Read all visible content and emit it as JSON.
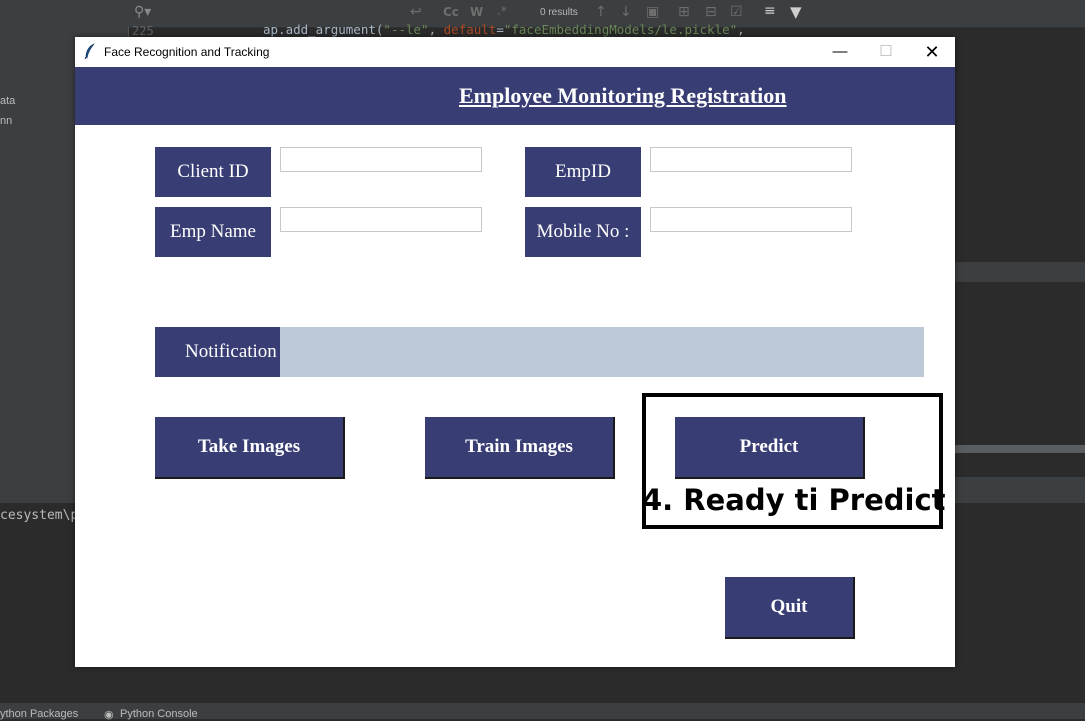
{
  "ide": {
    "line_number": "225",
    "code_prefix": "ap.add_argument(",
    "code_arg1": "\"--le\"",
    "code_sep": ", ",
    "code_kw": "default",
    "code_eq": "=",
    "code_arg2": "\"faceEmbeddingModels/le.pickle\"",
    "code_suffix": ",",
    "search_results": "0 results",
    "case_label": "Cc",
    "word_label": "W",
    "regex_label": ".*",
    "side_items": [
      "ata",
      "nn"
    ],
    "console_text": "cesystem\\p",
    "status_tabs": [
      "ython Packages",
      "Python Console"
    ]
  },
  "window": {
    "title": "Face Recognition and Tracking",
    "min_glyph": "—",
    "max_glyph": "☐",
    "close_glyph": "✕"
  },
  "header": {
    "title": "Employee Monitoring Registration"
  },
  "form": {
    "client_id_label": "Client ID",
    "client_id_value": "",
    "emp_id_label": "EmpID",
    "emp_id_value": "",
    "emp_name_label": "Emp Name",
    "emp_name_value": "",
    "mobile_label": "Mobile No :",
    "mobile_value": ""
  },
  "notification": {
    "label": "Notification",
    "message": ""
  },
  "actions": {
    "take_images": "Take Images",
    "train_images": "Train Images",
    "predict": "Predict",
    "quit": "Quit"
  },
  "annotation": {
    "text": "4. Ready ti Predict"
  },
  "colors": {
    "brand": "#383d74",
    "notification_bg": "#bdc9d7",
    "window_bg": "#ffffff"
  }
}
